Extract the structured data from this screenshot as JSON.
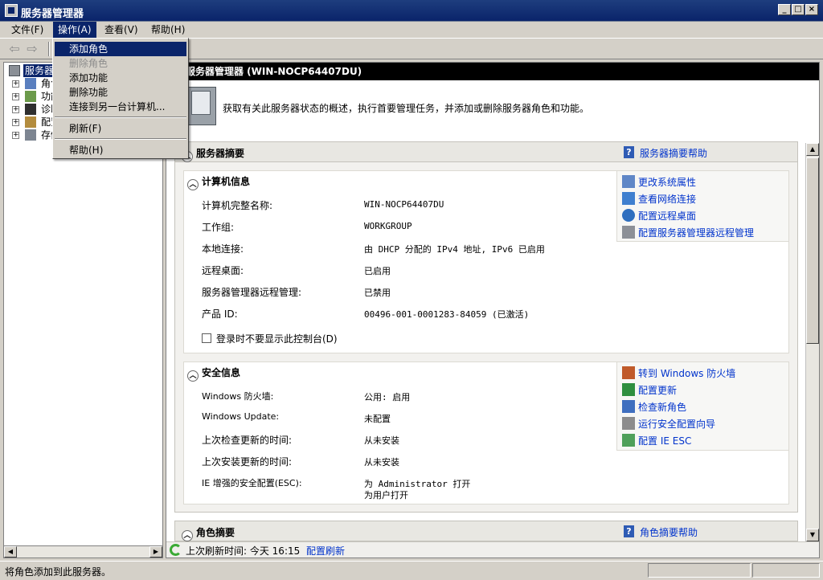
{
  "window": {
    "title": "服务器管理器",
    "controls": [
      "_",
      "□",
      "×"
    ]
  },
  "menubar": {
    "items": [
      {
        "label": "文件(F)"
      },
      {
        "label": "操作(A)"
      },
      {
        "label": "查看(V)"
      },
      {
        "label": "帮助(H)"
      }
    ]
  },
  "toolbar": {
    "back_icon": "back-arrow-icon",
    "forward_icon": "forward-arrow-icon"
  },
  "dropdown": {
    "items": [
      {
        "label": "添加角色",
        "highlighted": true
      },
      {
        "label": "删除角色",
        "disabled": true
      },
      {
        "label": "添加功能"
      },
      {
        "label": "删除功能"
      },
      {
        "label": "连接到另一台计算机..."
      },
      {
        "label": "刷新(F)"
      },
      {
        "label": "帮助(H)"
      }
    ]
  },
  "tree": {
    "items": [
      {
        "label": "服务器"
      },
      {
        "label": "角色"
      },
      {
        "label": "功能"
      },
      {
        "label": "诊断"
      },
      {
        "label": "配置"
      },
      {
        "label": "存储"
      }
    ]
  },
  "main": {
    "header": "服务器管理器 (WIN-NOCP64407DU)",
    "banner_text": "获取有关此服务器状态的概述，执行首要管理任务，并添加或删除服务器角色和功能。",
    "server_summary": {
      "title": "服务器摘要",
      "help_link": "服务器摘要帮助",
      "computer_info": {
        "title": "计算机信息",
        "rows": [
          {
            "label": "计算机完整名称:",
            "value": "WIN-NOCP64407DU"
          },
          {
            "label": "工作组:",
            "value": "WORKGROUP"
          },
          {
            "label": "本地连接:",
            "value": "由 DHCP 分配的 IPv4 地址, IPv6 已启用"
          },
          {
            "label": "远程桌面:",
            "value": "已启用"
          },
          {
            "label": "服务器管理器远程管理:",
            "value": "已禁用"
          },
          {
            "label": "产品 ID:",
            "value": "00496-001-0001283-84059 (已激活)"
          }
        ],
        "checkbox_label": "登录时不要显示此控制台(D)",
        "links": [
          {
            "label": "更改系统属性",
            "icon": "system-properties-icon"
          },
          {
            "label": "查看网络连接",
            "icon": "network-icon"
          },
          {
            "label": "配置远程桌面",
            "icon": "remote-desktop-icon"
          },
          {
            "label": "配置服务器管理器远程管理",
            "icon": "remote-management-icon"
          }
        ]
      },
      "security_info": {
        "title": "安全信息",
        "rows": [
          {
            "label": "Windows 防火墙:",
            "value": "公用: 启用"
          },
          {
            "label": "Windows Update:",
            "value": "未配置"
          },
          {
            "label": "上次检查更新的时间:",
            "value": "从未安装"
          },
          {
            "label": "上次安装更新的时间:",
            "value": "从未安装"
          },
          {
            "label": "IE 增强的安全配置(ESC):",
            "value": "为 Administrator 打开",
            "value2": "为用户打开"
          }
        ],
        "links": [
          {
            "label": "转到 Windows 防火墙",
            "icon": "firewall-icon"
          },
          {
            "label": "配置更新",
            "icon": "update-icon"
          },
          {
            "label": "检查新角色",
            "icon": "check-roles-icon"
          },
          {
            "label": "运行安全配置向导",
            "icon": "security-wizard-icon"
          },
          {
            "label": "配置 IE ESC",
            "icon": "ie-esc-icon"
          }
        ]
      }
    },
    "roles_summary": {
      "title": "角色摘要",
      "help_link": "角色摘要帮助"
    },
    "bottom": {
      "last_refresh_label": "上次刷新时间: 今天 16:15",
      "refresh_link": "配置刷新"
    }
  },
  "statusbar": {
    "text": "将角色添加到此服务器。"
  },
  "colors": {
    "title_bar": "#0a246a",
    "link": "#0033cc",
    "highlight": "#0a246a"
  }
}
